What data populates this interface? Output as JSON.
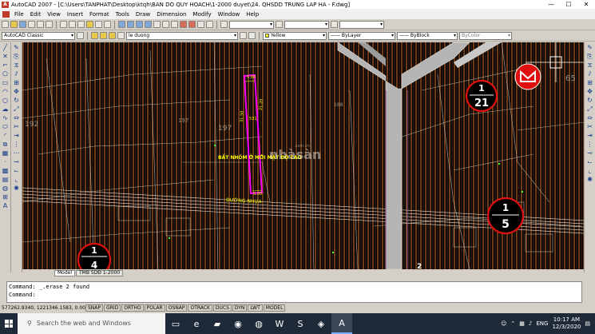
{
  "window": {
    "title": "AutoCAD 2007 - [C:\\Users\\TANPHAT\\Desktop\\ktqh\\BAN DO QUY HOACH\\1-2000 duyet\\24. QHSDD TRUNG LAP HA - F.dwg]",
    "app_icon_text": "A",
    "min": "—",
    "max": "☐",
    "close": "✕"
  },
  "menu": [
    "File",
    "Edit",
    "View",
    "Insert",
    "Format",
    "Tools",
    "Draw",
    "Dimension",
    "Modify",
    "Window",
    "Help"
  ],
  "toolbar": {
    "workspace": "AutoCAD Classic",
    "layer": "le duong",
    "color": "Yellow",
    "linetype": "ByLayer",
    "lineweight": "ByBlock",
    "plotstyle": "ByColor"
  },
  "drawing": {
    "lot_label": "BẤT NHÓM Ở MỚI MẬT ĐỘ CAO",
    "lot_dim_top": "5.00",
    "lot_dim_side1": "31.50",
    "lot_dim_side2": "21.20",
    "lot_area": "531",
    "lot_dim_bottom": "5.00",
    "road_label": "ĐƯỜNG NHỰA",
    "parcel_nums": [
      "197",
      "197",
      "192",
      "188"
    ],
    "right_number": "65",
    "watermark": "nhàsàn",
    "watermark_domain": ".com.vn",
    "marker_1_top": "1",
    "marker_1_bottom": "21",
    "marker_2_top": "1",
    "marker_2_bottom": "5",
    "marker_3_top": "1",
    "marker_3_bottom": "4",
    "bottom_number": "2"
  },
  "tabs": [
    "Model",
    "TMB SDĐ 1-2000"
  ],
  "command": {
    "line1": "Command:  _.erase 2 found",
    "line2": "Command:"
  },
  "status": {
    "coords": "577262.9340, 1221346.1583, 0.0000",
    "buttons": [
      "SNAP",
      "GRID",
      "ORTHO",
      "POLAR",
      "OSNAP",
      "OTRACK",
      "DUCS",
      "DYN",
      "LWT",
      "MODEL"
    ]
  },
  "taskbar": {
    "search_placeholder": "Search the web and Windows",
    "lang": "ENG",
    "time": "10:17 AM",
    "date": "12/3/2020"
  },
  "colors": {
    "canvas_bg": "#000000",
    "hatch": "#8a4a1c",
    "road": "#b5b5b5",
    "lot_outline": "#ff00ff",
    "label_yellow": "#ffff00",
    "marker_red": "#e01010"
  }
}
